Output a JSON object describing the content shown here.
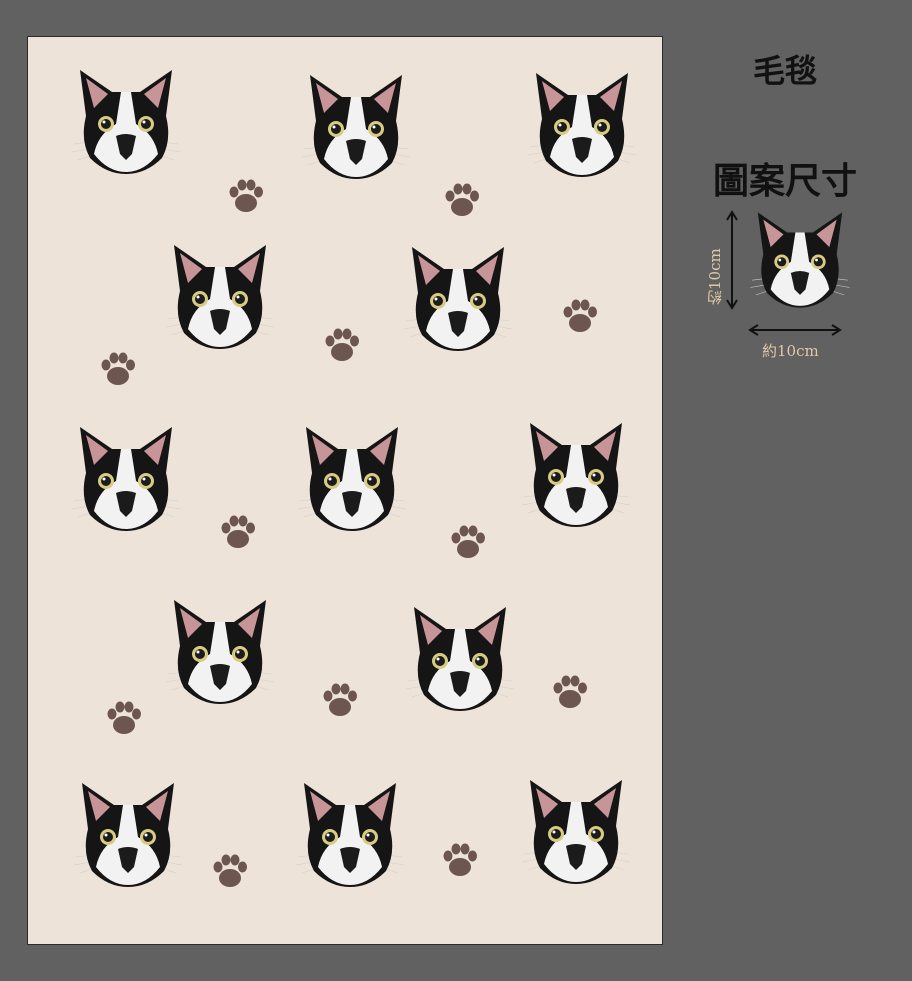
{
  "product": {
    "name": "毛毯",
    "pattern_size_label": "圖案尺寸",
    "height_label": "約10cm",
    "width_label": "約10cm"
  },
  "colors": {
    "background": "#616161",
    "blanket": "#ede3d8",
    "paw": "#6d5650",
    "dimension_text": "#e0c9a6"
  },
  "icons": {
    "cat_face": "cat-face-icon",
    "paw_print": "paw-print-icon"
  }
}
